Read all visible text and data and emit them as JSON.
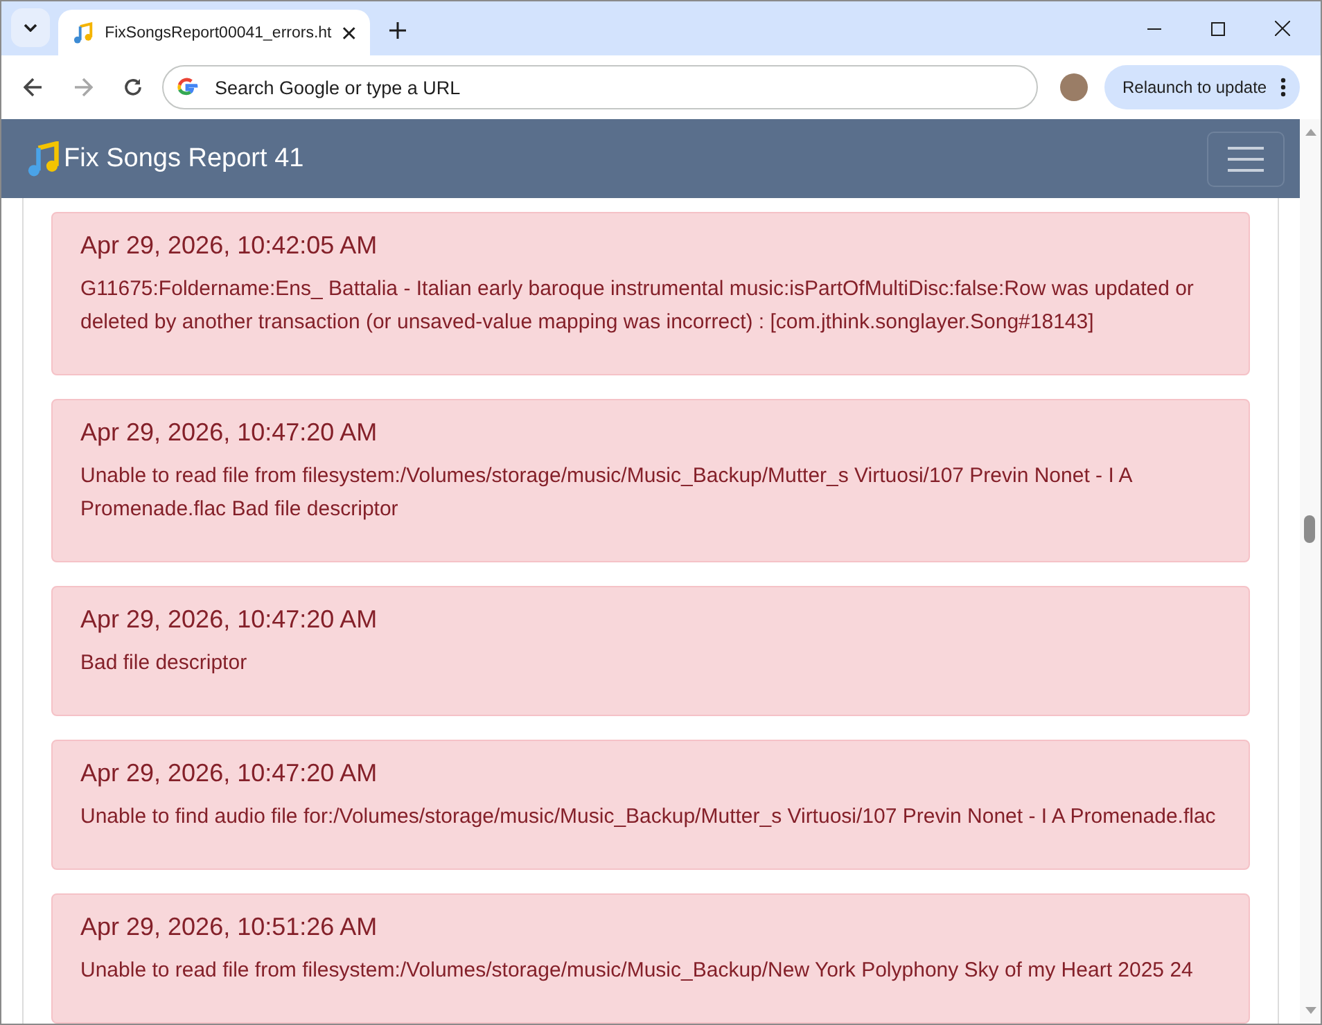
{
  "browser": {
    "tab_title": "FixSongsReport00041_errors.ht",
    "address_placeholder": "Search Google or type a URL",
    "relaunch_button": "Relaunch to update"
  },
  "navbar": {
    "title": "Fix Songs Report 41"
  },
  "errors": [
    {
      "time": "Apr 29, 2026, 10:42:05 AM",
      "message": "G11675:Foldername:Ens_ Battalia - Italian early baroque instrumental music:isPartOfMultiDisc:false:Row was updated or deleted by another transaction (or unsaved-value mapping was incorrect) : [com.jthink.songlayer.Song#18143]"
    },
    {
      "time": "Apr 29, 2026, 10:47:20 AM",
      "message": "Unable to read file from filesystem:/Volumes/storage/music/Music_Backup/Mutter_s Virtuosi/107 Previn Nonet - I A Promenade.flac Bad file descriptor"
    },
    {
      "time": "Apr 29, 2026, 10:47:20 AM",
      "message": "Bad file descriptor"
    },
    {
      "time": "Apr 29, 2026, 10:47:20 AM",
      "message": "Unable to find audio file for:/Volumes/storage/music/Music_Backup/Mutter_s Virtuosi/107 Previn Nonet - I A Promenade.flac"
    },
    {
      "time": "Apr 29, 2026, 10:51:26 AM",
      "message": "Unable to read file from filesystem:/Volumes/storage/music/Music_Backup/New York Polyphony Sky of my Heart 2025 24"
    }
  ]
}
